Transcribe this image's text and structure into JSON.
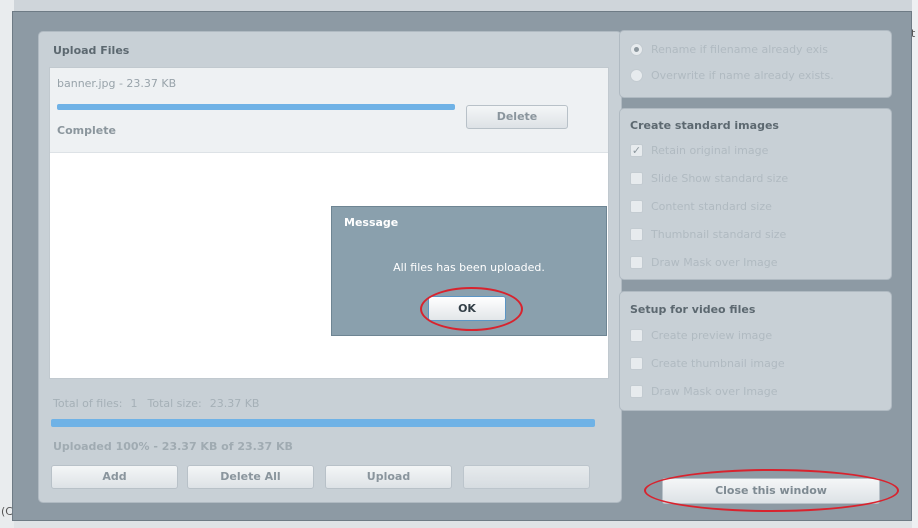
{
  "background": {
    "right_edge_char": "t",
    "left_edge_char": "(C"
  },
  "upload": {
    "title": "Upload Files",
    "file": {
      "name_size": "banner.jpg - 23.37 KB",
      "progress": 1.0,
      "status": "Complete",
      "delete_label": "Delete"
    },
    "total_files_label": "Total of files:",
    "total_files_value": "1",
    "total_size_label": "Total size:",
    "total_size_value": "23.37 KB",
    "overall_progress": 1.0,
    "uploaded_text": "Uploaded 100% - 23.37 KB of 23.37 KB",
    "buttons": {
      "add": "Add",
      "delete_all": "Delete All",
      "upload": "Upload",
      "cancel": ""
    }
  },
  "options": {
    "rename": {
      "label": "Rename if filename already exis",
      "selected": true
    },
    "overwrite": {
      "label": "Overwrite if name already exists.",
      "selected": false
    },
    "standard_images": {
      "title": "Create standard images",
      "items": [
        {
          "label": "Retain original image",
          "checked": true
        },
        {
          "label": "Slide Show standard size",
          "checked": false
        },
        {
          "label": "Content standard size",
          "checked": false
        },
        {
          "label": "Thumbnail standard size",
          "checked": false
        },
        {
          "label": "Draw Mask over Image",
          "checked": false
        }
      ]
    },
    "video": {
      "title": "Setup for video files",
      "items": [
        {
          "label": "Create preview image",
          "checked": false
        },
        {
          "label": "Create thumbnail image",
          "checked": false
        },
        {
          "label": "Draw Mask over Image",
          "checked": false
        }
      ]
    },
    "close_label": "Close this window"
  },
  "message": {
    "title": "Message",
    "text": "All files has been uploaded.",
    "ok_label": "OK"
  },
  "colors": {
    "highlight_ring": "#d8232e",
    "progress_fill": "#6fb2e6"
  }
}
